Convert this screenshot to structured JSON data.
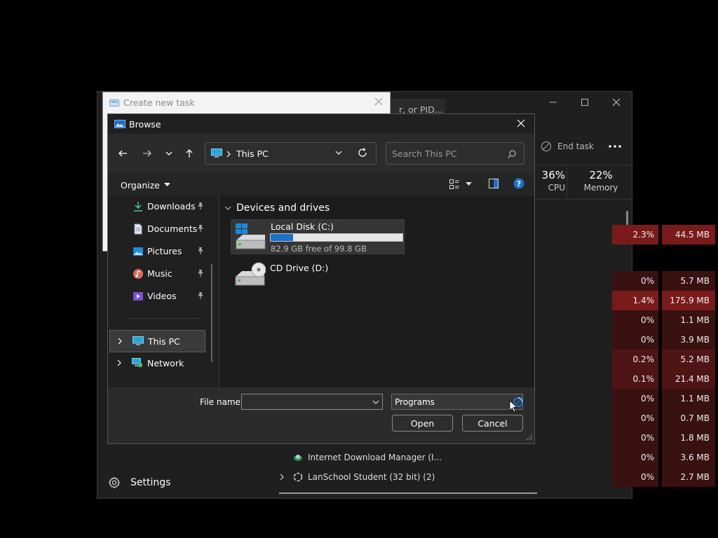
{
  "task_manager": {
    "search_placeholder_visible": "r, or PID...",
    "toolbar": {
      "end_task_label": "End task",
      "more_label": "..."
    },
    "columns": {
      "cpu": {
        "percent": "36%",
        "label": "CPU"
      },
      "memory": {
        "percent": "22%",
        "label": "Memory"
      }
    },
    "rows": [
      {
        "name": "",
        "cpu": "2.3%",
        "memory": "44.5 MB"
      },
      {
        "name": "",
        "cpu": "0%",
        "memory": "5.7 MB"
      },
      {
        "name": "",
        "cpu": "1.4%",
        "memory": "175.9 MB"
      },
      {
        "name": "",
        "cpu": "0%",
        "memory": "1.1 MB"
      },
      {
        "name": "",
        "cpu": "0%",
        "memory": "3.9 MB"
      },
      {
        "name": "",
        "cpu": "0.2%",
        "memory": "5.2 MB"
      },
      {
        "name": "",
        "cpu": "0.1%",
        "memory": "21.4 MB"
      },
      {
        "name": "",
        "cpu": "0%",
        "memory": "1.1 MB"
      },
      {
        "name": "",
        "cpu": "0%",
        "memory": "0.7 MB"
      },
      {
        "name": "",
        "cpu": "0%",
        "memory": "1.8 MB"
      },
      {
        "name": "Internet Download Manager (I...",
        "cpu": "0%",
        "memory": "3.6 MB"
      },
      {
        "name": "LanSchool Student (32 bit) (2)",
        "cpu": "0%",
        "memory": "2.7 MB"
      }
    ],
    "settings_label": "Settings",
    "colors": {
      "high": "#7a1b1b",
      "mid": "#4f1414",
      "low": "#3a1111"
    }
  },
  "create_new_task": {
    "title": "Create new task"
  },
  "browse": {
    "title": "Browse",
    "address": {
      "location": "This PC"
    },
    "search": {
      "placeholder": "Search This PC"
    },
    "organize_label": "Organize",
    "nav_pane": {
      "quick_access": [
        {
          "label": "Downloads",
          "icon": "download-icon"
        },
        {
          "label": "Documents",
          "icon": "document-icon"
        },
        {
          "label": "Pictures",
          "icon": "picture-icon"
        },
        {
          "label": "Music",
          "icon": "music-icon"
        },
        {
          "label": "Videos",
          "icon": "video-icon"
        }
      ],
      "this_pc": "This PC",
      "network": "Network"
    },
    "content": {
      "group_label": "Devices and drives",
      "drives": [
        {
          "name": "Local Disk (C:)",
          "free_text": "82.9 GB free of 99.8 GB",
          "used_fraction": 0.169
        },
        {
          "name": "CD Drive (D:)"
        }
      ]
    },
    "footer": {
      "file_name_label": "File name:",
      "file_name_value": "",
      "file_type_value": "Programs",
      "open_label": "Open",
      "cancel_label": "Cancel"
    },
    "colors": {
      "accent": "#1a72cc",
      "selected": "#3a3a3a"
    }
  }
}
